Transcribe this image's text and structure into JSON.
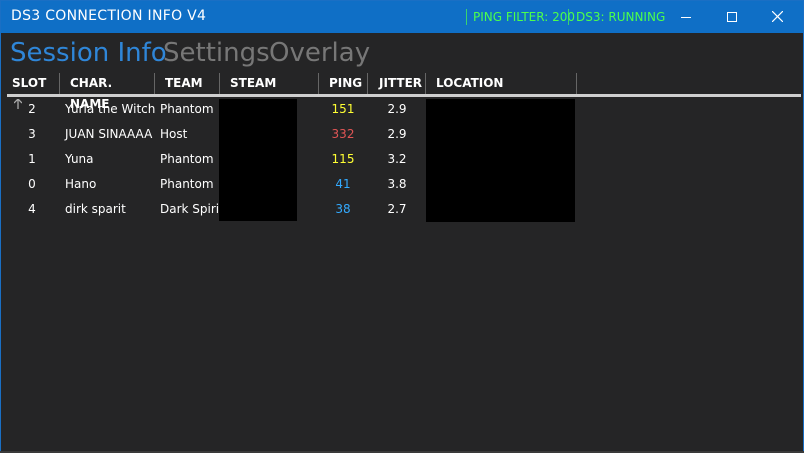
{
  "window": {
    "title": "DS3 CONNECTION INFO V4",
    "status_ping_filter": "PING FILTER: 200",
    "status_ds3": "DS3: RUNNING",
    "status_color": "#4cff4c",
    "accent": "#0f6fc6"
  },
  "tabs": [
    {
      "label": "Session Info",
      "active": true
    },
    {
      "label": "Settings",
      "active": false
    },
    {
      "label": "Overlay",
      "active": false
    }
  ],
  "table": {
    "columns": {
      "slot": "SLOT",
      "char_name": "CHAR. NAME",
      "team": "TEAM",
      "steam_name": "STEAM NAME",
      "ping": "PING",
      "jitter": "JITTER",
      "location": "LOCATION"
    },
    "sort_icon": "sort-ascending-arrow-icon",
    "rows": [
      {
        "slot": "2",
        "name": "Yuria the Witch",
        "team": "Phantom",
        "ping": "151",
        "ping_color": "#ffff33",
        "jitter": "2.9"
      },
      {
        "slot": "3",
        "name": "JUAN SINAAAA",
        "team": "Host",
        "ping": "332",
        "ping_color": "#e05555",
        "jitter": "2.9"
      },
      {
        "slot": "1",
        "name": "Yuna",
        "team": "Phantom",
        "ping": "115",
        "ping_color": "#ffff33",
        "jitter": "3.2"
      },
      {
        "slot": "0",
        "name": "Hano",
        "team": "Phantom",
        "ping": "41",
        "ping_color": "#33aaff",
        "jitter": "3.8"
      },
      {
        "slot": "4",
        "name": "dirk sparit",
        "team": "Dark Spirit",
        "ping": "38",
        "ping_color": "#33aaff",
        "jitter": "2.7"
      }
    ]
  }
}
